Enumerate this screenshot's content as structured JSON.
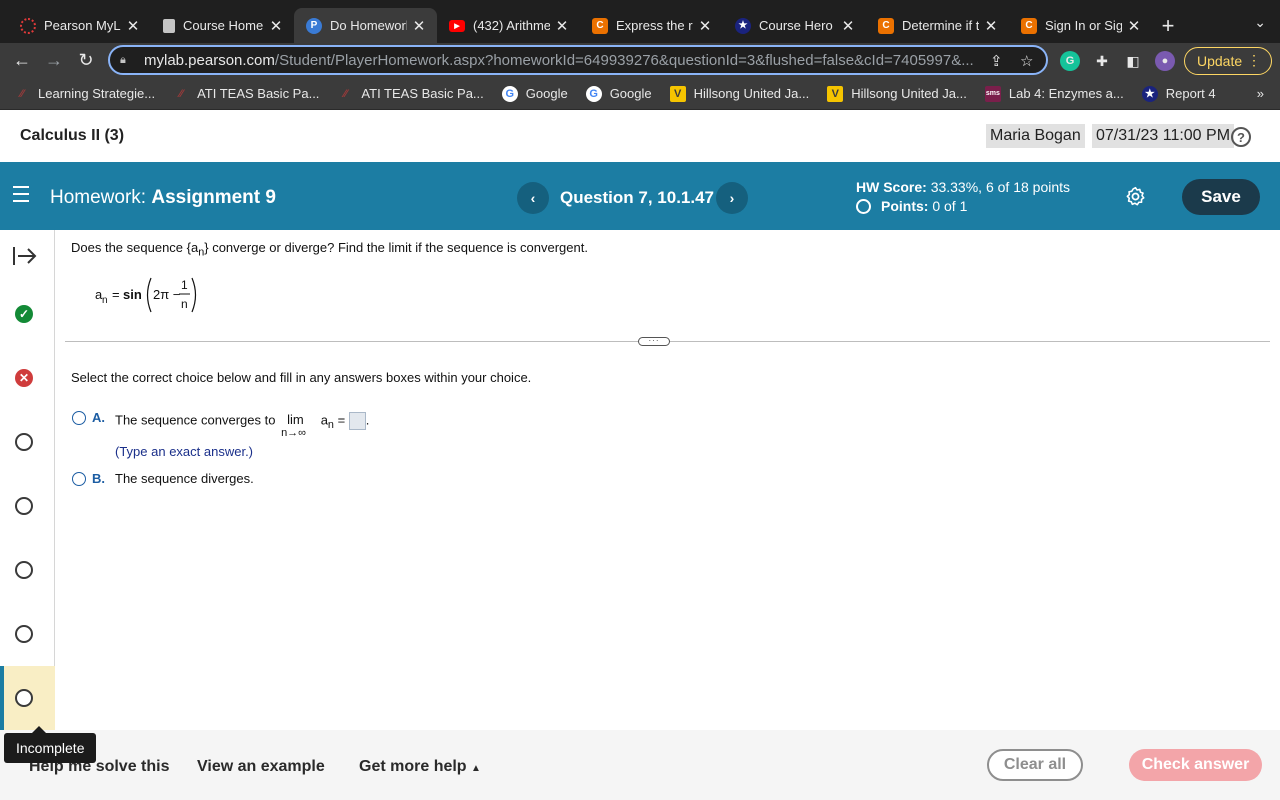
{
  "browser": {
    "tabs": [
      {
        "title": "Pearson MyLa",
        "favicon": "pearson-ring-icon",
        "color": "#e03a3a"
      },
      {
        "title": "Course Home",
        "favicon": "document-icon",
        "color": "#c4c4c4"
      },
      {
        "title": "Do Homework",
        "favicon": "pearson-p-icon",
        "color": "#3a7bd5",
        "active": true
      },
      {
        "title": "(432) Arithme",
        "favicon": "youtube-icon",
        "color": "#ff0000"
      },
      {
        "title": "Express the re",
        "favicon": "chegg-c-icon",
        "color": "#eb7100"
      },
      {
        "title": "Course Hero",
        "favicon": "star-icon",
        "color": "#1a237e"
      },
      {
        "title": "Determine if t",
        "favicon": "chegg-c-icon",
        "color": "#eb7100"
      },
      {
        "title": "Sign In or Sign",
        "favicon": "chegg-c-icon",
        "color": "#eb7100"
      }
    ],
    "url_host": "mylab.pearson.com",
    "url_path": "/Student/PlayerHomework.aspx?homeworkId=649939276&questionId=3&flushed=false&cId=7405997&...",
    "update_label": "Update",
    "bookmarks": [
      {
        "label": "Learning Strategie...",
        "icon": "ati-icon",
        "color": "#9c3b3b"
      },
      {
        "label": "ATI TEAS Basic Pa...",
        "icon": "ati-icon",
        "color": "#9c3b3b"
      },
      {
        "label": "ATI TEAS Basic Pa...",
        "icon": "ati-icon",
        "color": "#9c3b3b"
      },
      {
        "label": "Google",
        "icon": "google-icon",
        "color": "#4285f4"
      },
      {
        "label": "Google",
        "icon": "google-icon",
        "color": "#4285f4"
      },
      {
        "label": "Hillsong United Ja...",
        "icon": "hillsong-icon",
        "color": "#f5c400"
      },
      {
        "label": "Hillsong United Ja...",
        "icon": "hillsong-icon",
        "color": "#f5c400"
      },
      {
        "label": "Lab 4: Enzymes a...",
        "icon": "sms-icon",
        "color": "#7a1f4b"
      },
      {
        "label": "Report 4",
        "icon": "star-icon",
        "color": "#1a237e"
      }
    ],
    "bookmarks_more": "»"
  },
  "course": {
    "name": "Calculus II (3)",
    "user": "Maria Bogan",
    "due": "07/31/23 11:00 PM",
    "help_glyph": "?"
  },
  "homework": {
    "label": "Homework:",
    "assignment": "Assignment 9",
    "question": "Question 7, 10.1.47",
    "hw_score_label": "HW Score:",
    "hw_score_value": "33.33%, 6 of 18 points",
    "points_label": "Points:",
    "points_value": "0 of 1",
    "save_label": "Save",
    "accent": "#1c7da3"
  },
  "rail": {
    "statuses": [
      "correct",
      "wrong",
      "open",
      "open",
      "open",
      "open",
      "open"
    ],
    "tooltip": "Incomplete"
  },
  "question": {
    "prompt_before": "Does the sequence {a",
    "prompt_sub": "n",
    "prompt_after": "} converge or diverge? Find the limit if the sequence is convergent.",
    "formula_lhs": "a",
    "formula_sub": "n",
    "formula_eq": " = ",
    "formula_func": "sin",
    "formula_inner": "2π −",
    "formula_num": "1",
    "formula_den": "n",
    "instruction": "Select the correct choice below and fill in any answers boxes within your choice.",
    "choice_a_letter": "A.",
    "choice_a_text": "The sequence converges to",
    "choice_a_lim": "lim",
    "choice_a_lim_sub": "n→∞",
    "choice_a_an": "a",
    "choice_a_an_sub": "n",
    "choice_a_eq": "=",
    "choice_a_hint": "(Type an exact answer.)",
    "choice_b_letter": "B.",
    "choice_b_text": "The sequence diverges."
  },
  "footer": {
    "help_solve": "Help me solve this",
    "view_example": "View an example",
    "more_help": "Get more help",
    "clear_all": "Clear all",
    "check_answer": "Check answer"
  }
}
